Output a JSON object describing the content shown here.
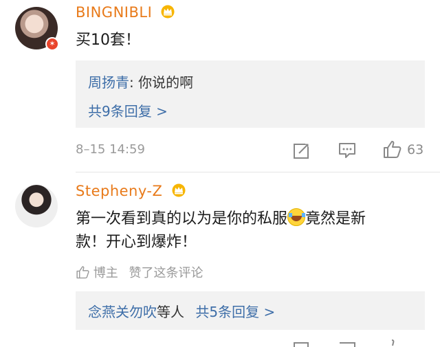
{
  "comments": [
    {
      "username": "BINGNIBLI",
      "text": "买10套！",
      "reply_preview": {
        "author": "周扬青",
        "text": ": 你说的啊"
      },
      "reply_more": "共9条回复 >",
      "timestamp": "8–15 14:59",
      "likes": "63"
    },
    {
      "username": "Stepheny-Z",
      "text_part1": "第一次看到真的以为是你的私服",
      "text_part2": "竟然是新",
      "text_line2": "款！开心到爆炸！",
      "blogger_like": {
        "label": "博主",
        "text": "赞了这条评论"
      },
      "reply_summary": {
        "names": "念燕关勿吹",
        "suffix": "等人",
        "more": "共5条回复 >"
      }
    }
  ],
  "icons": [
    "crown-icon",
    "edit-icon",
    "comment-icon",
    "thumb-up-icon",
    "laughing-crying-emoji"
  ],
  "colors": {
    "username": "#e87a1a",
    "link": "#3e6ea8",
    "meta": "#9a9a9a",
    "reply_bg": "#f2f2f2"
  }
}
